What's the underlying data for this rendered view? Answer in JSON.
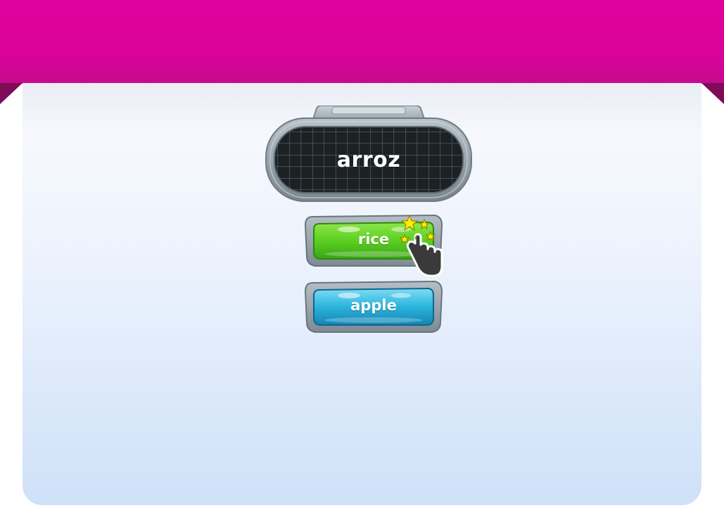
{
  "game": {
    "prompt_word": "arroz",
    "answers": [
      {
        "label": "rice",
        "color": "green",
        "state": "highlighted"
      },
      {
        "label": "apple",
        "color": "blue",
        "state": "normal"
      }
    ]
  },
  "colors": {
    "banner": "#e1029c",
    "banner_fold": "#7f0b59",
    "card_top": "#f6f8fd",
    "card_bottom": "#cfe1f8",
    "green_button": "#5cd023",
    "blue_button": "#2ab4dc",
    "stone_frame": "#8e9aa3",
    "star": "#ffee00"
  },
  "icons": {
    "cursor": "hand-pointer-icon",
    "sparkle": "star-icon"
  }
}
